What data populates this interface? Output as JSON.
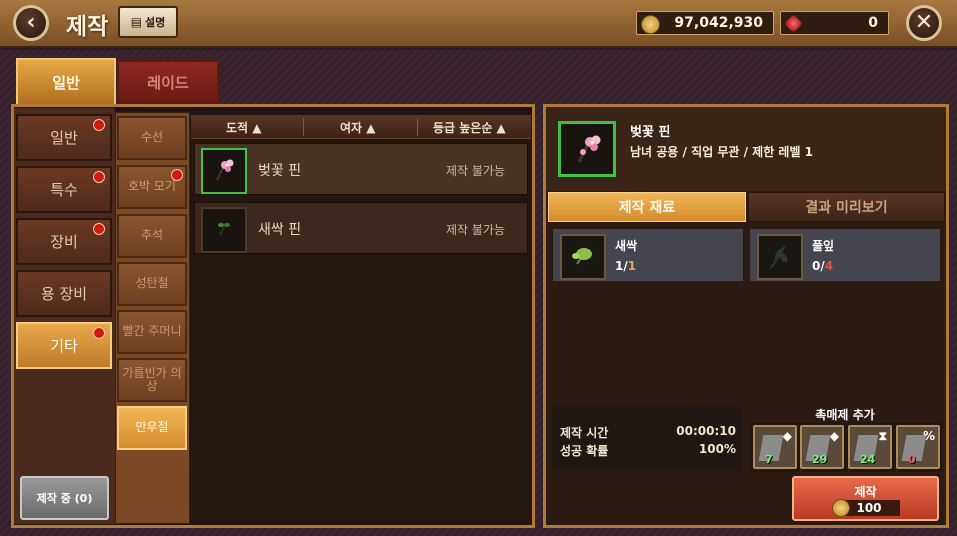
{
  "header": {
    "title": "제작",
    "help_label": "설명",
    "gold": "97,042,930",
    "gems": "0"
  },
  "tabs": {
    "normal": "일반",
    "raid": "레이드"
  },
  "categories": [
    {
      "label": "일반",
      "dot": true
    },
    {
      "label": "특수",
      "dot": true
    },
    {
      "label": "장비",
      "dot": true
    },
    {
      "label": "용 장비",
      "dot": false
    },
    {
      "label": "기타",
      "dot": true,
      "active": true
    }
  ],
  "subcategories": [
    {
      "label": "수선",
      "dot": false
    },
    {
      "label": "호박 모기",
      "dot": true
    },
    {
      "label": "추석",
      "dot": false
    },
    {
      "label": "성탄절",
      "dot": false
    },
    {
      "label": "빨간 주머니",
      "dot": false
    },
    {
      "label": "가름빈가 의상",
      "dot": false
    },
    {
      "label": "만우절",
      "dot": false,
      "active": true
    }
  ],
  "sort": {
    "male": "도적 ▲",
    "female": "여자 ▲",
    "grade": "등급 높은순 ▲"
  },
  "items": [
    {
      "name": "벚꽃 핀",
      "status": "제작 불가능"
    },
    {
      "name": "새싹 핀",
      "status": "제작 불가능"
    }
  ],
  "crafting_in_progress": "제작 중 (0)",
  "detail": {
    "name": "벚꽃 핀",
    "info": "남녀 공용 / 직업 무관 / 제한 레벨 1",
    "tab_materials": "제작 재료",
    "tab_preview": "결과 미리보기",
    "materials": [
      {
        "name": "새싹",
        "have": "1",
        "need": "1"
      },
      {
        "name": "풀잎",
        "have": "0",
        "need": "4"
      }
    ],
    "time_label": "제작 시간",
    "time_value": "00:00:10",
    "rate_label": "성공 확률",
    "rate_value": "100%",
    "catalyst_label": "촉매제 추가",
    "catalysts": [
      {
        "count": "7",
        "symbol": "◆"
      },
      {
        "count": "29",
        "symbol": "◆"
      },
      {
        "count": "24",
        "symbol": "⧗"
      },
      {
        "count": "0",
        "symbol": "%"
      }
    ],
    "craft_label": "제작",
    "craft_cost": "100"
  },
  "colors": {
    "accent": "#d48c2e",
    "border": "#b07a3a",
    "select_green": "#3dc14a",
    "craft_red": "#c84a30"
  }
}
